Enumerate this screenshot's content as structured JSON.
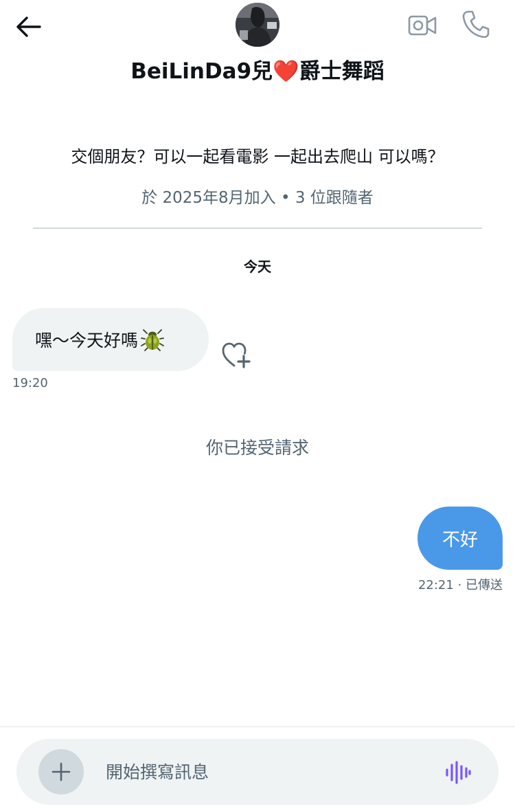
{
  "header": {
    "back_icon": "arrow-left-icon",
    "avatar_icon": "avatar",
    "video_icon": "video-camera-icon",
    "call_icon": "phone-icon",
    "profile_name_text": "BeiLinDa9兒",
    "profile_name_heart": "❤️",
    "profile_name_suffix": "爵士舞蹈"
  },
  "profile": {
    "bio": "交個朋友？可以一起看電影 一起出去爬山 可以嗎？",
    "joined": "於 2025年8月加入 • 3 位跟隨者"
  },
  "conversation": {
    "date_separator": "今天",
    "messages": [
      {
        "direction": "incoming",
        "text": "嘿～今天好嗎",
        "emoji_icon": "beetle-icon",
        "time": "19:20"
      },
      {
        "direction": "system",
        "text": "你已接受請求"
      },
      {
        "direction": "outgoing",
        "text": "不好",
        "status": "22:21 · 已傳送"
      }
    ]
  },
  "composer": {
    "placeholder": "開始撰寫訊息",
    "value": "",
    "add_icon": "plus-icon",
    "voice_icon": "voice-waveform-icon"
  },
  "colors": {
    "outgoing_bubble": "#4a99e9",
    "incoming_bubble": "#eff3f4",
    "secondary_text": "#536471",
    "voice_accent": "#7856ff"
  }
}
